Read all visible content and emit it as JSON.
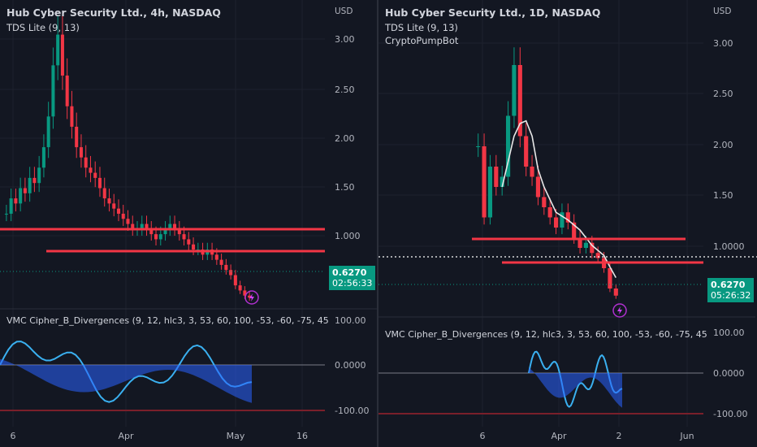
{
  "panes": [
    {
      "id": "left",
      "title": "Hub Cyber Security Ltd., 4h, NASDAQ",
      "indicators": [
        "TDS Lite (9, 13)"
      ],
      "currency": "USD",
      "price_ticks": [
        "3.00",
        "2.50",
        "2.00",
        "1.50",
        "1.000"
      ],
      "last_price": "0.6270",
      "countdown": "02:56:33",
      "oscillator_title": "VMC Cipher_B_Divergences (9, 12, hlc3, 3, 53, 60, 100, -53, -60, -75, 45",
      "osc_ticks": [
        "100.00",
        "0.0000",
        "-100.00"
      ],
      "time_ticks": [
        "6",
        "Apr",
        "May",
        "16"
      ]
    },
    {
      "id": "right",
      "title": "Hub Cyber Security Ltd., 1D, NASDAQ",
      "indicators": [
        "TDS Lite (9, 13)",
        "CryptoPumpBot"
      ],
      "currency": "USD",
      "price_ticks": [
        "3.00",
        "2.50",
        "2.00",
        "1.50",
        "1.0000"
      ],
      "last_price": "0.6270",
      "countdown": "05:26:32",
      "oscillator_title": "VMC Cipher_B_Divergences (9, 12, hlc3, 3, 53, 60, 100, -53, -60, -75, 45",
      "osc_ticks": [
        "100.00",
        "0.0000",
        "-100.00"
      ],
      "time_ticks": [
        "6",
        "Apr",
        "2",
        "Jun"
      ]
    }
  ],
  "chart_data": [
    {
      "type": "candlestick",
      "title": "Hub Cyber Security Ltd., 4h, NASDAQ",
      "x": [
        "6",
        "Apr",
        "May",
        "16"
      ],
      "ylim": [
        0.6,
        3.3
      ],
      "approx_closes": [
        1.45,
        1.6,
        1.55,
        1.7,
        1.65,
        1.8,
        1.75,
        1.9,
        2.1,
        2.4,
        2.9,
        3.2,
        2.8,
        2.5,
        2.3,
        2.1,
        2.0,
        1.9,
        1.85,
        1.8,
        1.7,
        1.6,
        1.55,
        1.5,
        1.45,
        1.4,
        1.35,
        1.3,
        1.3,
        1.35,
        1.3,
        1.25,
        1.2,
        1.25,
        1.3,
        1.35,
        1.3,
        1.25,
        1.2,
        1.15,
        1.1,
        1.1,
        1.05,
        1.1,
        1.05,
        1.0,
        0.95,
        0.9,
        0.85,
        0.75,
        0.7,
        0.65,
        0.63
      ],
      "horizontal_levels": [
        1.06,
        0.86
      ],
      "last_price": 0.627,
      "grid": true
    },
    {
      "type": "candlestick",
      "title": "Hub Cyber Security Ltd., 1D, NASDAQ",
      "x": [
        "6",
        "Apr",
        "2",
        "Jun"
      ],
      "ylim": [
        0.5,
        3.3
      ],
      "approx_closes": [
        2.1,
        1.4,
        1.9,
        1.7,
        1.8,
        2.4,
        2.9,
        2.2,
        1.9,
        1.8,
        1.6,
        1.5,
        1.4,
        1.3,
        1.45,
        1.35,
        1.2,
        1.1,
        1.15,
        1.05,
        1.0,
        0.9,
        0.7,
        0.63
      ],
      "horizontal_levels": [
        1.08,
        0.84,
        0.93
      ],
      "last_price": 0.627,
      "grid": true
    }
  ]
}
